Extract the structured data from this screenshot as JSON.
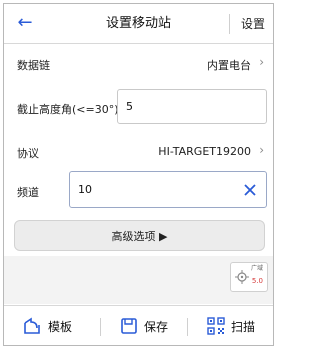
{
  "header": {
    "back_icon": "arrow-left-icon",
    "title": "设置移动站",
    "action_label": "设置"
  },
  "rows": {
    "datalink": {
      "label": "数据链",
      "value": "内置电台"
    },
    "elevation_mask": {
      "label": "截止高度角(<=30°)",
      "value": "5"
    },
    "protocol": {
      "label": "协议",
      "value": "HI-TARGET19200"
    },
    "channel": {
      "label": "频道",
      "value": "10"
    }
  },
  "advanced_button": {
    "label": "高级选项 ▶"
  },
  "gps_widget": {
    "label": "广域",
    "value": "5.0"
  },
  "footer": {
    "template_label": "模板",
    "save_label": "保存",
    "scan_label": "扫描"
  },
  "colors": {
    "accent": "#2a5bd7",
    "red": "#d63b3b"
  }
}
